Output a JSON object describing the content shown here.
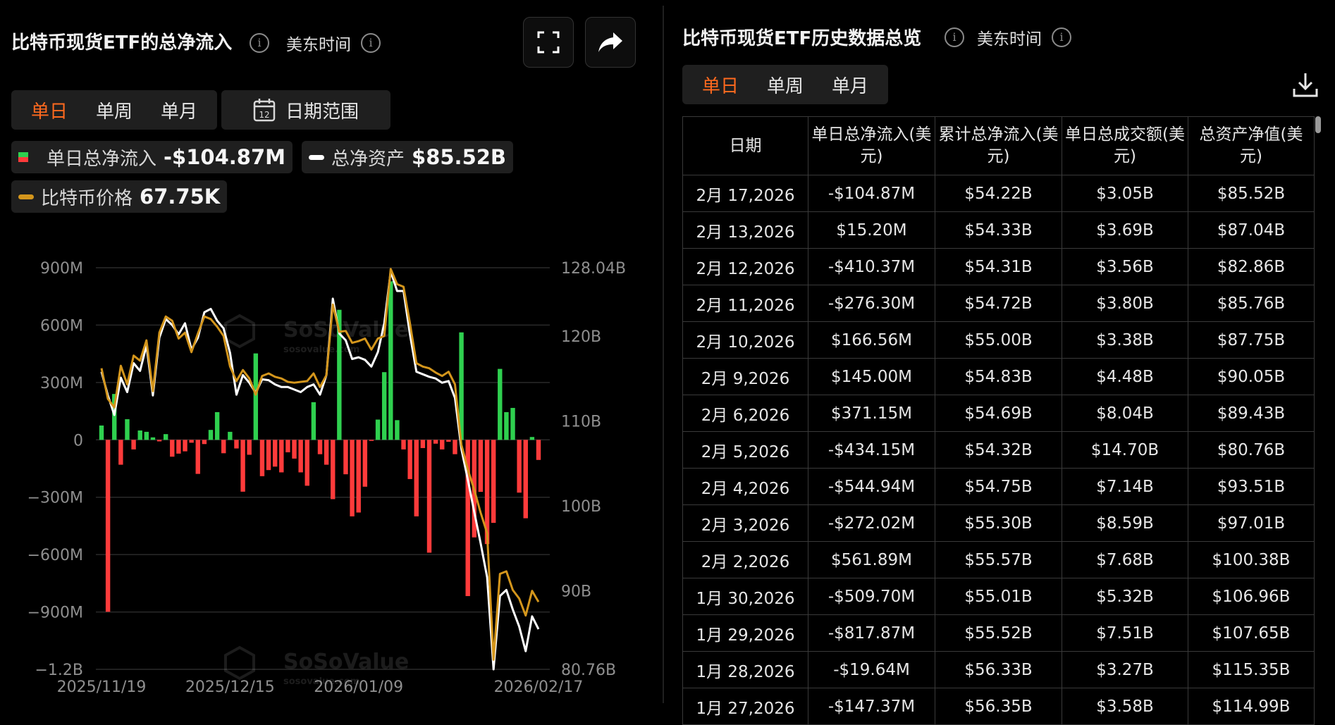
{
  "left": {
    "title": "比特币现货ETF的总净流入",
    "timezone": "美东时间",
    "tabs": [
      "单日",
      "单周",
      "单月"
    ],
    "active_tab": 0,
    "date_range_label": "日期范围",
    "calendar_day": "12",
    "legend": {
      "net_inflow_label": "单日总净流入",
      "net_inflow_value": "-$104.87M",
      "net_assets_label": "总净资产",
      "net_assets_value": "$85.52B",
      "btc_price_label": "比特币价格",
      "btc_price_value": "67.75K"
    }
  },
  "right": {
    "title": "比特币现货ETF历史数据总览",
    "timezone": "美东时间",
    "tabs": [
      "单日",
      "单周",
      "单月"
    ],
    "active_tab": 0,
    "columns": [
      "日期",
      "单日总净流入(美元)",
      "累计总净流入(美元)",
      "单日总成交额(美元)",
      "总资产净值(美元)"
    ],
    "rows": [
      [
        "2月 17,2026",
        "-$104.87M",
        "$54.22B",
        "$3.05B",
        "$85.52B"
      ],
      [
        "2月 13,2026",
        "$15.20M",
        "$54.33B",
        "$3.69B",
        "$87.04B"
      ],
      [
        "2月 12,2026",
        "-$410.37M",
        "$54.31B",
        "$3.56B",
        "$82.86B"
      ],
      [
        "2月 11,2026",
        "-$276.30M",
        "$54.72B",
        "$3.80B",
        "$85.76B"
      ],
      [
        "2月 10,2026",
        "$166.56M",
        "$55.00B",
        "$3.38B",
        "$87.75B"
      ],
      [
        "2月 9,2026",
        "$145.00M",
        "$54.83B",
        "$4.48B",
        "$90.05B"
      ],
      [
        "2月 6,2026",
        "$371.15M",
        "$54.69B",
        "$8.04B",
        "$89.43B"
      ],
      [
        "2月 5,2026",
        "-$434.15M",
        "$54.32B",
        "$14.70B",
        "$80.76B"
      ],
      [
        "2月 4,2026",
        "-$544.94M",
        "$54.75B",
        "$7.14B",
        "$93.51B"
      ],
      [
        "2月 3,2026",
        "-$272.02M",
        "$55.30B",
        "$8.59B",
        "$97.01B"
      ],
      [
        "2月 2,2026",
        "$561.89M",
        "$55.57B",
        "$7.68B",
        "$100.38B"
      ],
      [
        "1月 30,2026",
        "-$509.70M",
        "$55.01B",
        "$5.32B",
        "$106.96B"
      ],
      [
        "1月 29,2026",
        "-$817.87M",
        "$55.52B",
        "$7.51B",
        "$107.65B"
      ],
      [
        "1月 28,2026",
        "-$19.64M",
        "$56.33B",
        "$3.27B",
        "$115.35B"
      ],
      [
        "1月 27,2026",
        "-$147.37M",
        "$56.35B",
        "$3.58B",
        "$114.99B"
      ]
    ]
  },
  "watermark": {
    "brand": "SoSoValue",
    "site": "sosovalue.com"
  },
  "colors": {
    "accent": "#ff6a1f",
    "inflow": "#2fd04f",
    "outflow": "#ff3b3b",
    "net_assets_line": "#ffffff",
    "btc_price_line": "#d4961c"
  },
  "chart_data": {
    "type": "bar",
    "title": "",
    "x_tick_labels": [
      "2025/11/19",
      "2025/12/15",
      "2026/01/09",
      "2026/02/17"
    ],
    "y_left": {
      "ticks": [
        "900M",
        "600M",
        "300M",
        "0",
        "−300M",
        "−600M",
        "−900M",
        "−1.2B"
      ],
      "ylim": [
        -1200,
        900
      ],
      "unit": "M"
    },
    "y_right": {
      "ticks": [
        "128.04B",
        "120B",
        "110B",
        "100B",
        "90B",
        "80.76B"
      ],
      "ylim": [
        80.76,
        128.04
      ],
      "unit": "B"
    },
    "series": [
      {
        "name": "单日总净流入",
        "type": "bar",
        "values": [
          75,
          -899,
          240,
          -130,
          108,
          -50,
          49,
          42,
          13,
          -8,
          30,
          -88,
          -72,
          -60,
          -15,
          -178,
          -22,
          52,
          145,
          -70,
          42,
          -45,
          -271,
          -78,
          452,
          -190,
          -158,
          -140,
          -170,
          -65,
          -98,
          -170,
          -240,
          197,
          -75,
          -130,
          -310,
          680,
          -180,
          -400,
          -380,
          -245,
          -5,
          106,
          354,
          829,
          103,
          -50,
          -205,
          -400,
          -43,
          -590,
          -20,
          -50,
          -10,
          -75,
          562,
          -817,
          -510,
          -272,
          -545,
          -434,
          371,
          145,
          167,
          -276,
          -410,
          15,
          -105
        ]
      },
      {
        "name": "总净资产",
        "type": "line",
        "values": [
          115.8,
          113.0,
          110.7,
          115.1,
          113.4,
          116.8,
          115.9,
          118.9,
          113.0,
          119.8,
          122.0,
          121.3,
          120.2,
          121.5,
          118.4,
          119.8,
          122.8,
          123.2,
          121.8,
          120.9,
          118.0,
          113.1,
          115.4,
          114.5,
          113.3,
          114.9,
          114.8,
          114.3,
          114.0,
          114.0,
          113.7,
          113.4,
          114.0,
          114.3,
          113.1,
          115.4,
          124.4,
          120.3,
          119.5,
          117.3,
          117.5,
          117.2,
          116.4,
          118.1,
          121.5,
          127.6,
          125.3,
          125.3,
          120.2,
          115.8,
          115.5,
          115.2,
          115.0,
          114.5,
          114.7,
          112.7,
          106.7,
          103.1,
          99.3,
          95.6,
          91.6,
          80.76,
          89.4,
          90.1,
          87.8,
          85.8,
          82.9,
          87.0,
          85.5
        ]
      },
      {
        "name": "比特币价格",
        "type": "line",
        "values": [
          116.2,
          112.6,
          111.6,
          116.5,
          114.3,
          117.7,
          117.1,
          119.5,
          113.5,
          120.4,
          122.3,
          121.8,
          119.7,
          120.4,
          118.1,
          120.3,
          122.3,
          122.0,
          121.1,
          120.0,
          116.4,
          114.7,
          116.0,
          115.0,
          113.1,
          115.3,
          115.6,
          115.2,
          115.0,
          114.6,
          114.5,
          114.6,
          114.7,
          115.6,
          114.0,
          115.4,
          123.7,
          120.5,
          120.6,
          119.2,
          119.4,
          119.7,
          118.4,
          119.7,
          120.0,
          127.9,
          126.1,
          125.8,
          121.5,
          116.8,
          116.4,
          116.2,
          115.7,
          115.3,
          115.8,
          114.3,
          107.2,
          104.3,
          101.9,
          99.2,
          96.8,
          81.9,
          92.0,
          92.3,
          90.1,
          89.1,
          87.1,
          90.0,
          88.7
        ]
      }
    ]
  }
}
